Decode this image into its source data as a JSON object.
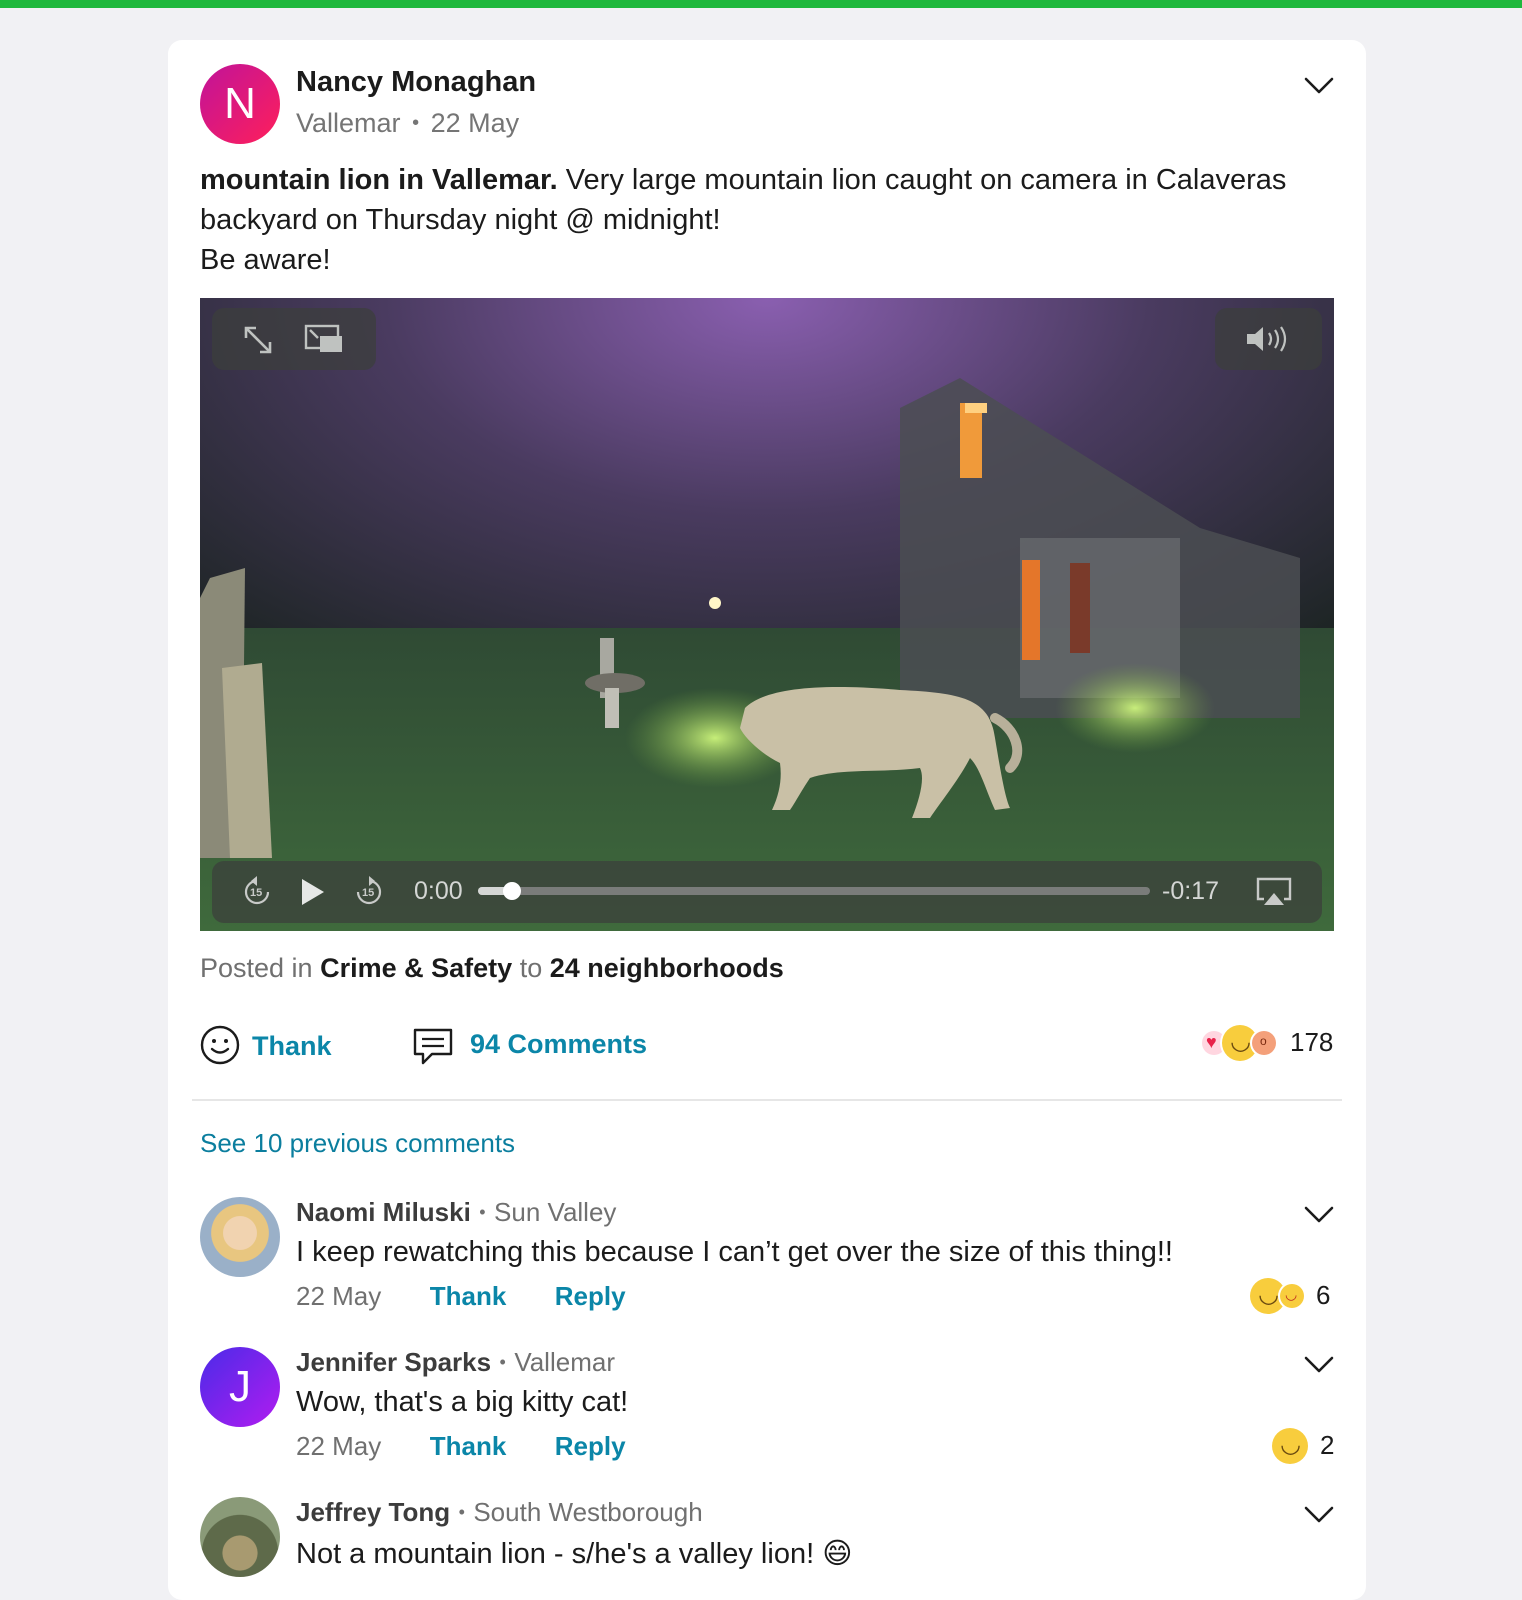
{
  "post": {
    "author": "Nancy Monaghan",
    "avatar_initial": "N",
    "neighborhood": "Vallemar",
    "separator": "•",
    "date": "22 May",
    "title": "mountain lion in Vallemar.",
    "body_line1": " Very large mountain lion caught on camera in Calaveras",
    "body_line2": "backyard on Thursday night @ midnight!",
    "body_line3": "Be aware!",
    "options_icon": "chevron-down-icon"
  },
  "video": {
    "current_time": "0:00",
    "remaining_time": "-0:17",
    "progress_fraction": 0.05,
    "skip_back_label": "15",
    "skip_forward_label": "15",
    "icons": [
      "expand-icon",
      "picture-in-picture-icon",
      "volume-icon",
      "rewind-15-icon",
      "play-icon",
      "forward-15-icon",
      "airplay-icon"
    ]
  },
  "posted_in": {
    "prefix": "Posted in",
    "category": "Crime & Safety",
    "to_word": "to",
    "audience": "24 neighborhoods"
  },
  "actions": {
    "thank_label": "Thank",
    "comments_label": "94 Comments",
    "reaction_count": "178"
  },
  "see_previous": "See 10 previous comments",
  "comments": [
    {
      "name": "Naomi Miluski",
      "location": "Sun Valley",
      "text": "I keep rewatching this because I can’t get over the size of this thing!!",
      "date": "22 May",
      "thank": "Thank",
      "reply": "Reply",
      "reaction_count": "6"
    },
    {
      "name": "Jennifer Sparks",
      "avatar_initial": "J",
      "location": "Vallemar",
      "text": "Wow, that's a big kitty cat!",
      "date": "22 May",
      "thank": "Thank",
      "reply": "Reply",
      "reaction_count": "2"
    },
    {
      "name": "Jeffrey Tong",
      "location": "South Westborough",
      "text": "Not a mountain lion - s/he's a valley lion!",
      "text_emoji": "😄"
    }
  ],
  "colors": {
    "accent": "#0b86a8",
    "brand_green": "#1fb83d",
    "avatar_n": "#e0117f",
    "avatar_j": "#7a22f0"
  }
}
